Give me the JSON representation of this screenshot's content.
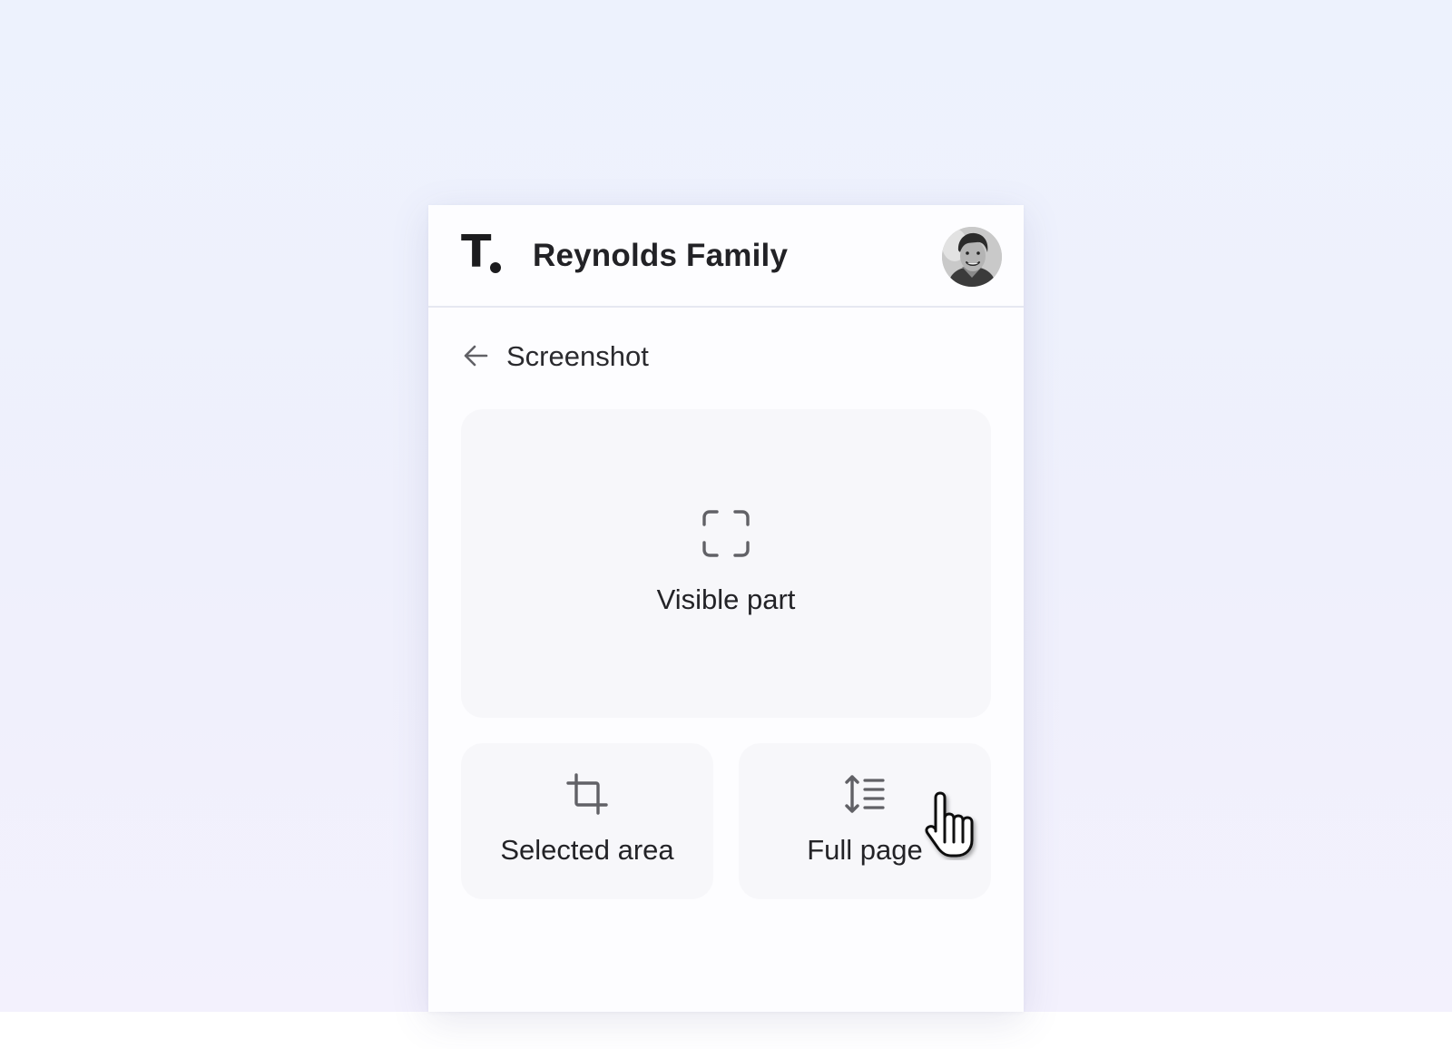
{
  "header": {
    "logo_text": "T",
    "workspace_title": "Reynolds Family",
    "avatar_icon": "user-avatar-photo"
  },
  "nav": {
    "back_icon": "arrow-left-icon",
    "title": "Screenshot"
  },
  "options": {
    "visible_part": {
      "label": "Visible part",
      "icon": "fullscreen-corners-icon"
    },
    "selected_area": {
      "label": "Selected area",
      "icon": "crop-icon"
    },
    "full_page": {
      "label": "Full page",
      "icon": "vertical-expand-lines-icon"
    }
  },
  "cursor": {
    "icon": "hand-pointer-icon"
  },
  "colors": {
    "background": "#edf2fd",
    "panel": "#fdfdff",
    "card": "#f7f7fa",
    "text": "#232327",
    "icon": "#616166"
  }
}
